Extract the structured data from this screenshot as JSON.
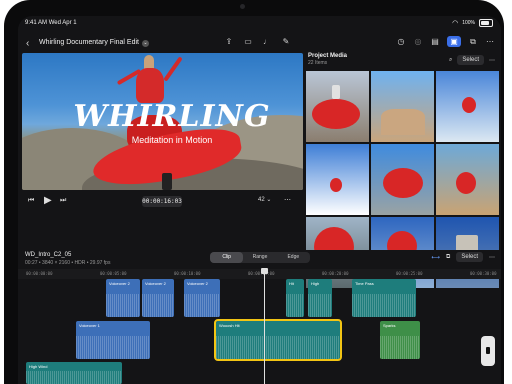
{
  "status": {
    "time": "9:41 AM",
    "date": "Wed Apr 1",
    "battery": "100%"
  },
  "toolbar": {
    "back_icon": "chevron-left-icon",
    "project_title": "Whirling Documentary Final Edit",
    "tools": [
      "import-icon",
      "camera-icon",
      "mic-icon",
      "live-draw-icon"
    ],
    "right_tools": [
      "timer-icon",
      "compass-icon",
      "inspector-icon",
      "media-browser-icon",
      "layers-icon",
      "more-icon"
    ]
  },
  "viewer": {
    "title_text": "WHIRLING",
    "subtitle_text": "Meditation in Motion",
    "timecode": "00:00:16:03",
    "zoom": "42"
  },
  "media": {
    "title": "Project Media",
    "count": "22 Items",
    "select_label": "Select"
  },
  "timeline": {
    "clip_name": "WD_Intro_C2_05",
    "clip_meta": "00:27 • 3840 × 2160 • HDR • 29.97 fps",
    "segments": [
      "Clip",
      "Range",
      "Edge"
    ],
    "active_segment": "Clip",
    "select_label": "Select",
    "ruler": [
      "00:00:00:00",
      "00:00:05:00",
      "00:00:10:00",
      "00:00:15:00",
      "00:00:20:00",
      "00:00:25:00",
      "00:00:30:00",
      "00:00:35:00"
    ],
    "clips": [
      {
        "label": "Voiceover 2"
      },
      {
        "label": "Voiceover 2"
      },
      {
        "label": "Voiceover 2"
      },
      {
        "label": "Hit"
      },
      {
        "label": "High"
      },
      {
        "label": "Time Pass"
      },
      {
        "label": "Voiceover 1"
      },
      {
        "label": "Wooosh Hit"
      },
      {
        "label": "Sparks"
      },
      {
        "label": "High Wind"
      }
    ]
  }
}
